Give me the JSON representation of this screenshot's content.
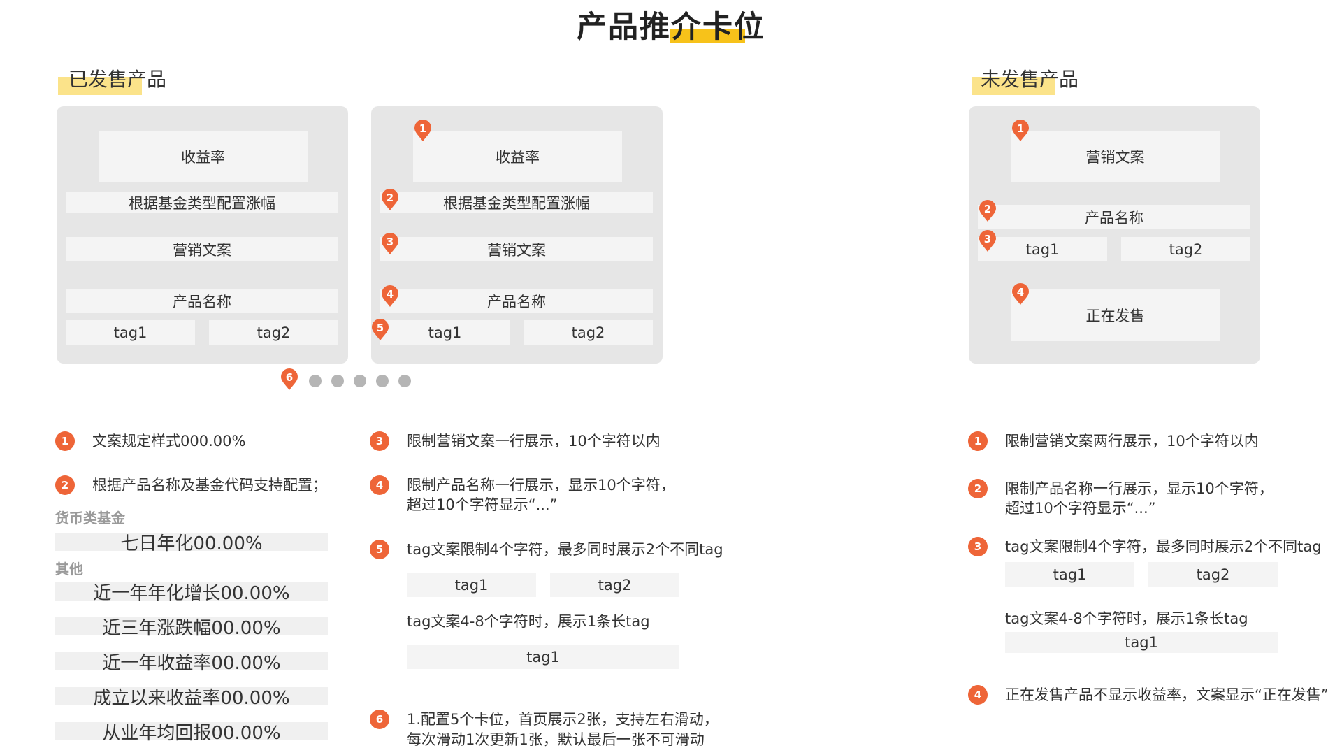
{
  "page_title": "产品推介卡位",
  "sold": {
    "title": "已发售产品",
    "rate": "收益率",
    "change": "根据基金类型配置涨幅",
    "marketing": "营销文案",
    "product_name": "产品名称",
    "tag1": "tag1",
    "tag2": "tag2"
  },
  "unsold": {
    "title": "未发售产品",
    "marketing": "营销文案",
    "product_name": "产品名称",
    "tag1": "tag1",
    "tag2": "tag2",
    "status": "正在发售"
  },
  "pins": [
    "1",
    "2",
    "3",
    "4",
    "5",
    "6"
  ],
  "pagination": {
    "dot_count": 5
  },
  "notes_left": {
    "n1": "文案规定样式000.00%",
    "n2": "根据产品名称及基金代码支持配置；",
    "money_fund": "货币类基金",
    "seven_day": "七日年化00.00%",
    "other": "其他",
    "examples": [
      "近一年年化增长00.00%",
      "近三年涨跌幅00.00%",
      "近一年收益率00.00%",
      "成立以来收益率00.00%",
      "从业年均回报00.00%"
    ]
  },
  "notes_mid": {
    "n3": "限制营销文案一行展示，10个字符以内",
    "n4_l1": "限制产品名称一行展示，显示10个字符，",
    "n4_l2": "超过10个字符显示“...”",
    "n5": "tag文案限制4个字符，最多同时展示2个不同tag",
    "tag1": "tag1",
    "tag2": "tag2",
    "long_tag_note": "tag文案4-8个字符时，展示1条长tag",
    "long_tag": "tag1",
    "n6_l1": "1.配置5个卡位，首页展示2张，支持左右滑动，",
    "n6_l2": "每次滑动1次更新1张，默认最后一张不可滑动"
  },
  "notes_right": {
    "n1": "限制营销文案两行展示，10个字符以内",
    "n2_l1": "限制产品名称一行展示，显示10个字符，",
    "n2_l2": "超过10个字符显示“...”",
    "n3": "tag文案限制4个字符，最多同时展示2个不同tag",
    "tag1": "tag1",
    "tag2": "tag2",
    "long_tag_note": "tag文案4-8个字符时，展示1条长tag",
    "long_tag": "tag1",
    "n4": "正在发售产品不显示收益率，文案显示“正在发售”"
  },
  "colors": {
    "accent": "#ee6538",
    "highlight": "#f7c21a",
    "panel": "#e6e6e6",
    "block": "#f4f4f4"
  }
}
